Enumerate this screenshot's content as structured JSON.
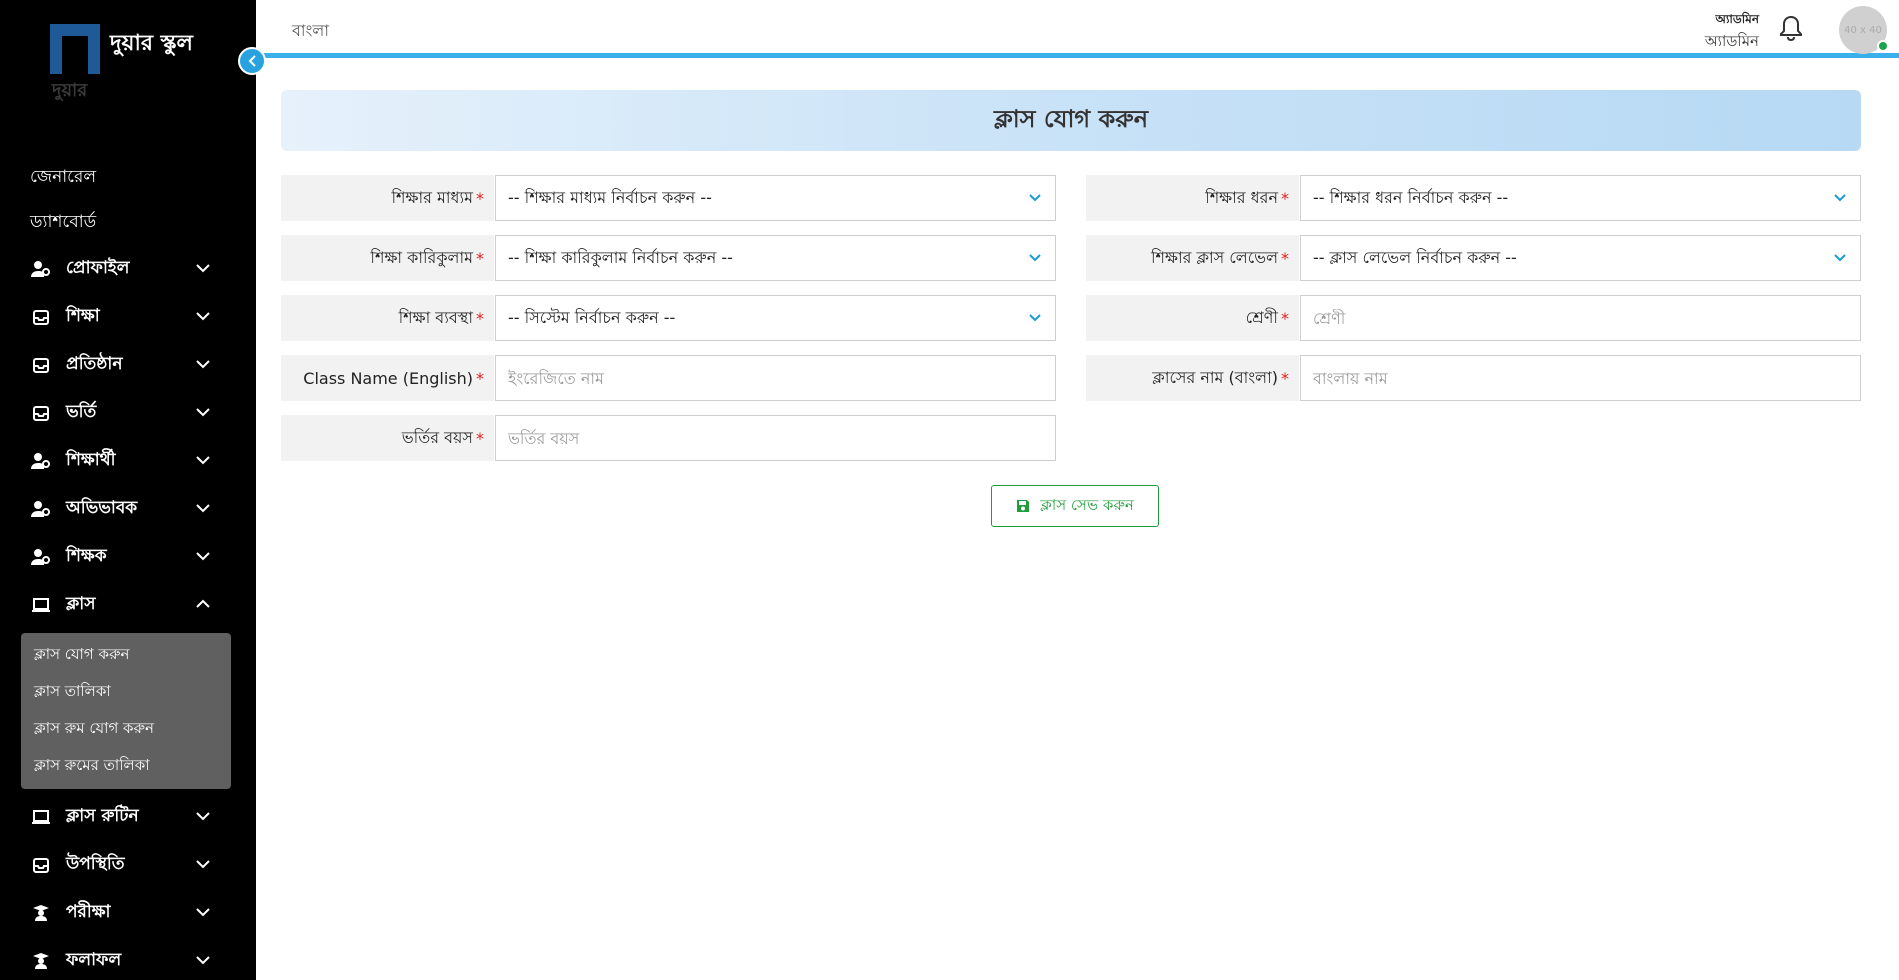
{
  "brand": {
    "name": "দুয়ার স্কুল",
    "subtitle": "দুয়ার"
  },
  "topbar": {
    "language": "বাংলা",
    "user_role": "অ্যাডমিন",
    "user_name": "অ্যাডমিন",
    "avatar_text": "40 x 40"
  },
  "sidebar": {
    "general": "জেনারেল",
    "dashboard": "ড্যাশবোর্ড",
    "items": [
      {
        "label": "প্রোফাইল",
        "icon": "user-gear-icon"
      },
      {
        "label": "শিক্ষা",
        "icon": "inbox-icon"
      },
      {
        "label": "প্রতিষ্ঠান",
        "icon": "inbox-icon"
      },
      {
        "label": "ভর্তি",
        "icon": "inbox-icon"
      },
      {
        "label": "শিক্ষার্থী",
        "icon": "user-gear-icon"
      },
      {
        "label": "অভিভাবক",
        "icon": "user-gear-icon"
      },
      {
        "label": "শিক্ষক",
        "icon": "user-gear-icon"
      },
      {
        "label": "ক্লাস",
        "icon": "laptop-icon",
        "expanded": true
      },
      {
        "label": "ক্লাস রুটিন",
        "icon": "laptop-icon"
      },
      {
        "label": "উপস্থিতি",
        "icon": "inbox-icon"
      },
      {
        "label": "পরীক্ষা",
        "icon": "graduate-icon"
      },
      {
        "label": "ফলাফল",
        "icon": "graduate-icon"
      }
    ],
    "class_submenu": [
      "ক্লাস যোগ করুন",
      "ক্লাস তালিকা",
      "ক্লাস রুম যোগ করুন",
      "ক্লাস রুমের তালিকা"
    ]
  },
  "page": {
    "title": "ক্লাস যোগ করুন",
    "save_label": "ক্লাস সেভ করুন"
  },
  "form": {
    "medium": {
      "label": "শিক্ষার মাধ্যম",
      "required": "*",
      "value": "-- শিক্ষার মাধ্যম নির্বাচন করুন --"
    },
    "type": {
      "label": "শিক্ষার ধরন",
      "required": "*",
      "value": "-- শিক্ষার ধরন নির্বাচন করুন --"
    },
    "curriculum": {
      "label": "শিক্ষা কারিকুলাম",
      "required": "*",
      "value": "-- শিক্ষা কারিকুলাম নির্বাচন করুন --"
    },
    "class_level": {
      "label": "শিক্ষার ক্লাস লেভেল",
      "required": "*",
      "value": "-- ক্লাস লেভেল নির্বাচন করুন --"
    },
    "system": {
      "label": "শিক্ষা ব্যবস্থা",
      "required": "*",
      "value": "-- সিস্টেম নির্বাচন করুন --"
    },
    "grade": {
      "label": "শ্রেণী",
      "required": "*",
      "placeholder": "শ্রেণী"
    },
    "name_en": {
      "label": "Class Name (English)",
      "required": "*",
      "placeholder": "ইংরেজিতে নাম"
    },
    "name_bn": {
      "label": "ক্লাসের নাম (বাংলা)",
      "required": "*",
      "placeholder": "বাংলায় নাম"
    },
    "admission_age": {
      "label": "ভর্তির বয়স",
      "required": "*",
      "placeholder": "ভর্তির বয়স"
    }
  },
  "colors": {
    "accent": "#39b0ec",
    "save": "#1f9d3a",
    "required": "#e02020",
    "sidebar": "#000000"
  }
}
